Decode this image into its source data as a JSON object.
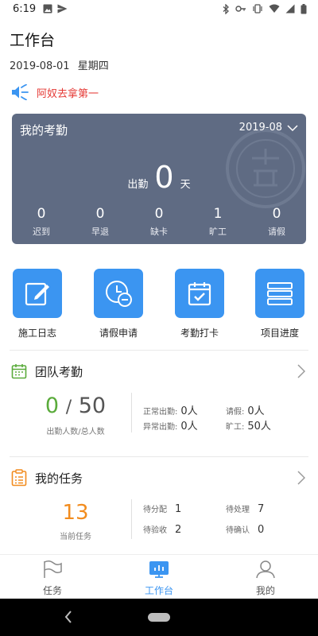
{
  "status_bar": {
    "time": "6:19"
  },
  "header": {
    "title": "工作台",
    "date": "2019-08-01",
    "weekday": "星期四"
  },
  "notice": {
    "text": "阿奴去拿第一",
    "icon": "speaker-icon"
  },
  "attendance_card": {
    "title": "我的考勤",
    "month": "2019-08",
    "days_label": "出勤",
    "days_value": "0",
    "days_unit": "天",
    "stats": [
      {
        "value": "0",
        "label": "迟到"
      },
      {
        "value": "0",
        "label": "早退"
      },
      {
        "value": "0",
        "label": "缺卡"
      },
      {
        "value": "1",
        "label": "旷工"
      },
      {
        "value": "0",
        "label": "请假"
      }
    ]
  },
  "tools": [
    {
      "label": "施工日志",
      "icon": "edit-log-icon"
    },
    {
      "label": "请假申请",
      "icon": "leave-clock-icon"
    },
    {
      "label": "考勤打卡",
      "icon": "calendar-check-icon"
    },
    {
      "label": "项目进度",
      "icon": "progress-list-icon"
    }
  ],
  "team_attendance": {
    "title": "团队考勤",
    "present": "0",
    "separator": "/",
    "total": "50",
    "caption": "出勤人数/总人数",
    "normal_label": "正常出勤:",
    "normal_value": "0人",
    "leave_label": "请假:",
    "leave_value": "0人",
    "abnormal_label": "异常出勤:",
    "abnormal_value": "0人",
    "absent_label": "旷工:",
    "absent_value": "50人"
  },
  "my_tasks": {
    "title": "我的任务",
    "current_value": "13",
    "current_label": "当前任务",
    "to_assign_label": "待分配",
    "to_assign_value": "1",
    "to_handle_label": "待处理",
    "to_handle_value": "7",
    "to_accept_label": "待验收",
    "to_accept_value": "2",
    "to_confirm_label": "待确认",
    "to_confirm_value": "0"
  },
  "tab_bar": {
    "tabs": [
      {
        "label": "任务",
        "icon": "flag-icon"
      },
      {
        "label": "工作台",
        "icon": "dashboard-icon"
      },
      {
        "label": "我的",
        "icon": "person-icon"
      }
    ]
  },
  "colors": {
    "accent": "#3b95f1",
    "card_bg": "#5f6b83",
    "notice_red": "#e53935",
    "team_green": "#5aab3b",
    "task_orange": "#f28c1e"
  }
}
